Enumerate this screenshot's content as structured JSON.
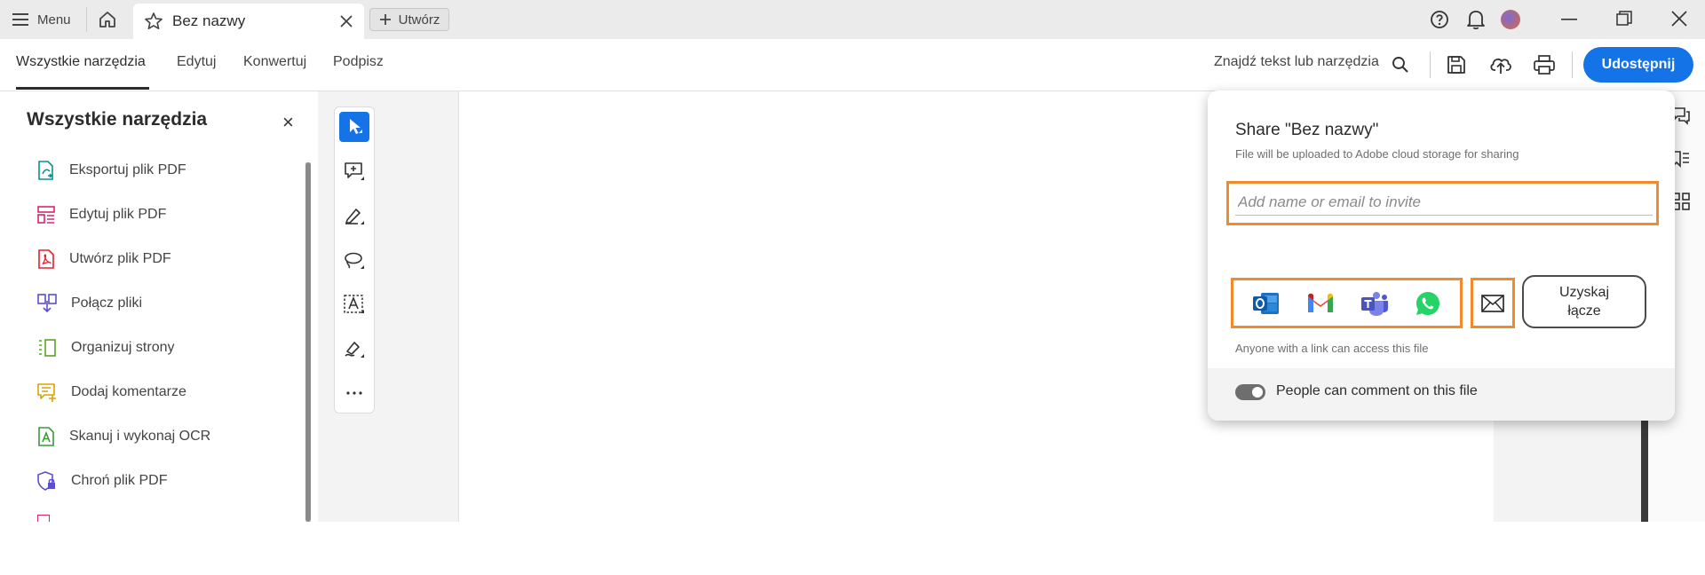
{
  "titlebar": {
    "menu_label": "Menu",
    "tab_title": "Bez nazwy",
    "new_label": "Utwórz"
  },
  "toolbar": {
    "tabs": [
      "Wszystkie narzędzia",
      "Edytuj",
      "Konwertuj",
      "Podpisz"
    ],
    "active_tab": "Wszystkie narzędzia",
    "search_label": "Znajdź tekst lub narzędzia",
    "share_label": "Udostępnij"
  },
  "left_panel": {
    "title": "Wszystkie narzędzia",
    "close": "×",
    "items": [
      {
        "label": "Eksportuj plik PDF",
        "icon": "export-pdf-icon",
        "color": "#0d8f8f"
      },
      {
        "label": "Edytuj plik PDF",
        "icon": "edit-pdf-icon",
        "color": "#d6266f"
      },
      {
        "label": "Utwórz plik PDF",
        "icon": "create-pdf-icon",
        "color": "#e3202e"
      },
      {
        "label": "Połącz pliki",
        "icon": "combine-files-icon",
        "color": "#5a4fd1"
      },
      {
        "label": "Organizuj strony",
        "icon": "organize-pages-icon",
        "color": "#5aa22a"
      },
      {
        "label": "Dodaj komentarze",
        "icon": "add-comments-icon",
        "color": "#d9a300"
      },
      {
        "label": "Skanuj i wykonaj OCR",
        "icon": "scan-ocr-icon",
        "color": "#3a9a3a"
      },
      {
        "label": "Chroń plik PDF",
        "icon": "protect-pdf-icon",
        "color": "#5a4fd1"
      }
    ]
  },
  "vertical_tools": [
    "select-arrow-icon",
    "add-comment-icon",
    "highlight-pen-icon",
    "lasso-icon",
    "text-box-icon",
    "signature-pen-icon",
    "more-icon"
  ],
  "share_popover": {
    "title": "Share \"Bez nazwy\"",
    "subtitle": "File will be uploaded to Adobe cloud storage for sharing",
    "invite_placeholder": "Add name or email to invite",
    "apps": [
      "outlook-icon",
      "gmail-icon",
      "teams-icon",
      "whatsapp-icon"
    ],
    "email_icon": "envelope-icon",
    "get_link_label": "Uzyskaj łącze",
    "access_note": "Anyone with a link can access this file",
    "comment_toggle_label": "People can comment on this file",
    "comment_toggle_on": true,
    "highlight_color": "#f08a2c"
  },
  "colors": {
    "accent": "#1473e6",
    "titlebar_bg": "#ebebeb"
  }
}
